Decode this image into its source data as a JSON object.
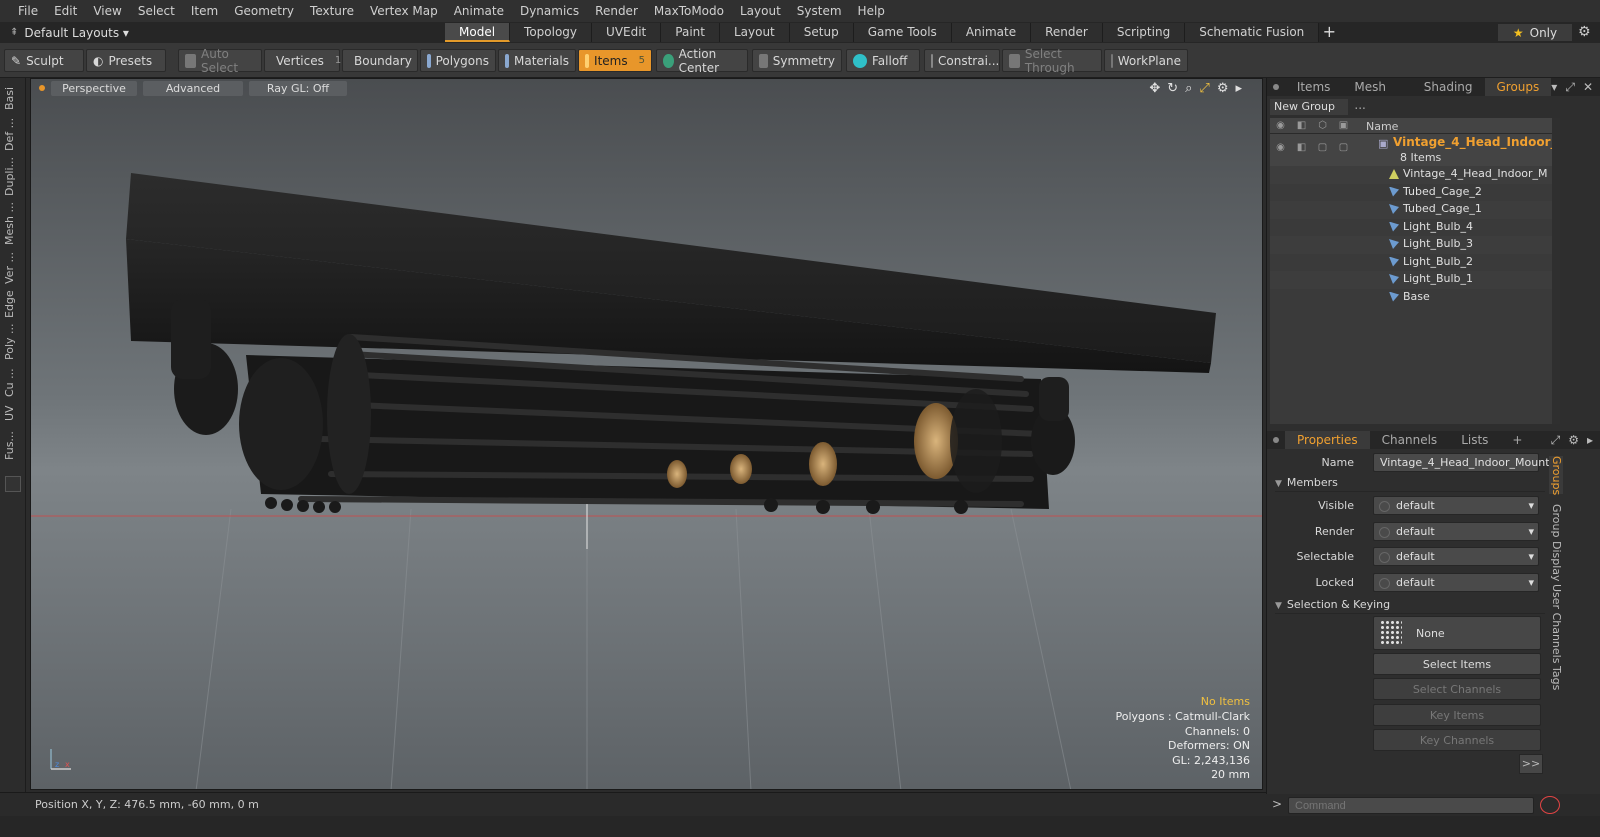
{
  "menu": [
    "File",
    "Edit",
    "View",
    "Select",
    "Item",
    "Geometry",
    "Texture",
    "Vertex Map",
    "Animate",
    "Dynamics",
    "Render",
    "MaxToModo",
    "Layout",
    "System",
    "Help"
  ],
  "layout": {
    "label": "Default Layouts ▾"
  },
  "tabs": [
    {
      "label": "Model",
      "active": true
    },
    {
      "label": "Topology"
    },
    {
      "label": "UVEdit"
    },
    {
      "label": "Paint"
    },
    {
      "label": "Layout"
    },
    {
      "label": "Setup"
    },
    {
      "label": "Game Tools"
    },
    {
      "label": "Animate"
    },
    {
      "label": "Render"
    },
    {
      "label": "Scripting"
    },
    {
      "label": "Schematic Fusion"
    }
  ],
  "tabs_plus": "+",
  "only": {
    "label": "Only",
    "star": "★"
  },
  "toolbar": {
    "sculpt": "Sculpt",
    "presets": "Presets",
    "auto_select": "Auto Select",
    "vertices": "Vertices",
    "vertices_count": "1",
    "boundary": "Boundary",
    "polygons": "Polygons",
    "materials": "Materials",
    "items": "Items",
    "items_count": "5",
    "action_center": "Action Center",
    "symmetry": "Symmetry",
    "falloff": "Falloff",
    "constraints": "Constrai...",
    "select_through": "Select Through",
    "workplane": "WorkPlane"
  },
  "left_tabs": [
    "Basi",
    "Def ...",
    "Dupli...",
    "Mesh ...",
    "Ver ...",
    "Edge",
    "Poly ...",
    "Cu ...",
    "UV",
    "Fus..."
  ],
  "viewport": {
    "perspective": "Perspective",
    "advanced": "Advanced",
    "raygl": "Ray GL: Off",
    "info": {
      "no_items": "No Items",
      "polygons": "Polygons : Catmull-Clark",
      "channels": "Channels: 0",
      "deformers": "Deformers: ON",
      "gl": "GL: 2,243,136",
      "scale": "20 mm"
    }
  },
  "status": {
    "position": "Position X, Y, Z:  476.5 mm, -60 mm, 0 m"
  },
  "top_panel": {
    "tabs": [
      {
        "label": "Items"
      },
      {
        "label": "Mesh ..."
      },
      {
        "label": "Shading"
      },
      {
        "label": "Groups",
        "active": true
      }
    ],
    "new_group": "New Group",
    "name_col": "Name",
    "group": {
      "name": "Vintage_4_Head_Indoor_...",
      "count": "8 Items"
    },
    "items": [
      "Vintage_4_Head_Indoor_M ...",
      "Tubed_Cage_2",
      "Tubed_Cage_1",
      "Light_Bulb_4",
      "Light_Bulb_3",
      "Light_Bulb_2",
      "Light_Bulb_1",
      "Base"
    ]
  },
  "props_panel": {
    "tabs": [
      {
        "label": "Properties",
        "active": true
      },
      {
        "label": "Channels"
      },
      {
        "label": "Lists"
      }
    ],
    "plus": "+",
    "name_label": "Name",
    "name_value": "Vintage_4_Head_Indoor_Mount_",
    "members_header": "Members",
    "visible_label": "Visible",
    "visible_value": "default",
    "render_label": "Render",
    "render_value": "default",
    "selectable_label": "Selectable",
    "selectable_value": "default",
    "locked_label": "Locked",
    "locked_value": "default",
    "selection_header": "Selection & Keying",
    "none_label": "None",
    "select_items": "Select Items",
    "select_channels": "Select Channels",
    "key_items": "Key Items",
    "key_channels": "Key Channels",
    "more": ">>",
    "side_tabs": [
      "Groups",
      "Group Display",
      "User Channels",
      "Tags"
    ]
  },
  "command": {
    "placeholder": "Command",
    "arrow": ">"
  }
}
